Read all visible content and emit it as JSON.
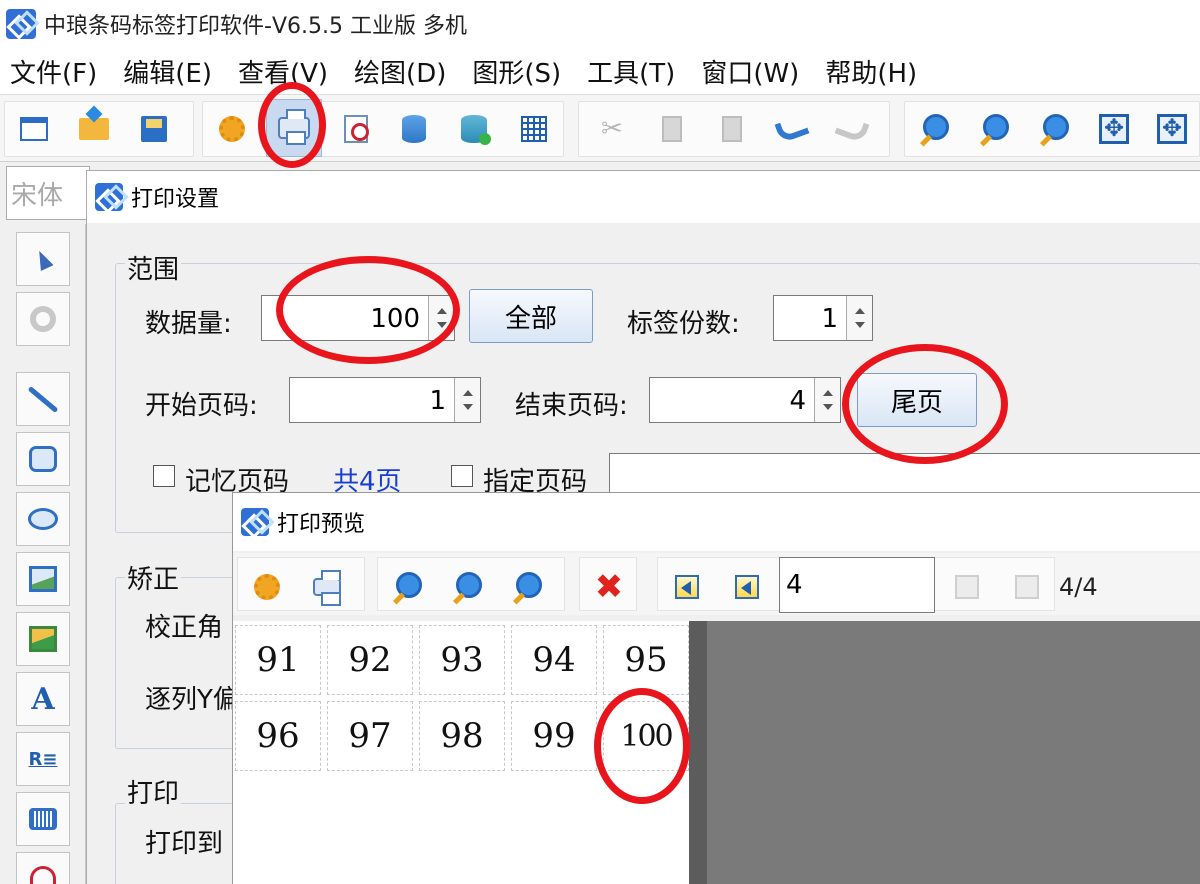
{
  "app": {
    "title": "中琅条码标签打印软件-V6.5.5 工业版 多机"
  },
  "menu": [
    "文件(F)",
    "编辑(E)",
    "查看(V)",
    "绘图(D)",
    "图形(S)",
    "工具(T)",
    "窗口(W)",
    "帮助(H)"
  ],
  "font_box": {
    "value": "宋体"
  },
  "print_dialog": {
    "title": "打印设置",
    "range_group": "范围",
    "data_amount_label": "数据量:",
    "data_amount_value": "100",
    "all_button": "全部",
    "copies_label": "标签份数:",
    "copies_value": "1",
    "start_page_label": "开始页码:",
    "start_page_value": "1",
    "end_page_label": "结束页码:",
    "end_page_value": "4",
    "last_page_button": "尾页",
    "remember_page_label": "记忆页码",
    "total_pages_text": "共4页",
    "specify_page_label": "指定页码",
    "correction_group": "矫正",
    "correction_angle_label": "校正角",
    "column_offset_label": "逐列Y偏",
    "print_group": "打印",
    "print_to_label": "打印到"
  },
  "preview_dialog": {
    "title": "打印预览",
    "page_input_value": "4",
    "page_counter": "4/4",
    "labels": [
      [
        "91",
        "92",
        "93",
        "94",
        "95"
      ],
      [
        "96",
        "97",
        "98",
        "99",
        "100"
      ]
    ]
  },
  "colors": {
    "annotation_red": "#e8161c",
    "link_blue": "#1a3fd0",
    "brand_blue": "#2f6fd6"
  }
}
